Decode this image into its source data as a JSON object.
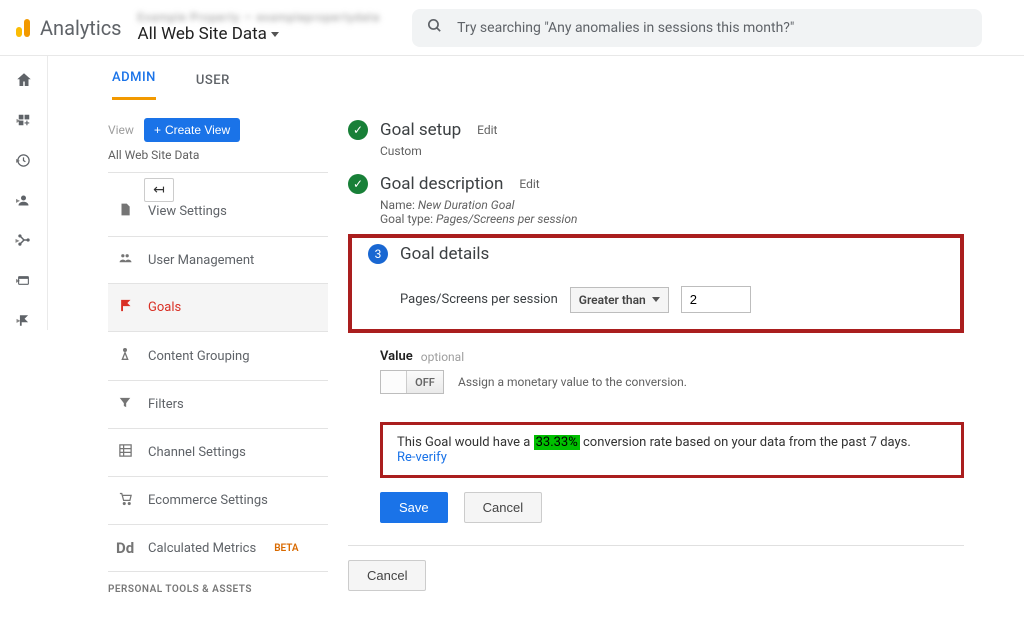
{
  "header": {
    "product": "Analytics",
    "property_top": "Example Property — examplepropertydata",
    "property_bottom": "All Web Site Data",
    "search_placeholder": "Try searching \"Any anomalies in sessions this month?\""
  },
  "tabs": {
    "admin": "ADMIN",
    "user": "USER"
  },
  "sidebar": {
    "view_label": "View",
    "create_view": "Create View",
    "view_name": "All Web Site Data",
    "items": [
      {
        "label": "View Settings"
      },
      {
        "label": "User Management"
      },
      {
        "label": "Goals"
      },
      {
        "label": "Content Grouping"
      },
      {
        "label": "Filters"
      },
      {
        "label": "Channel Settings"
      },
      {
        "label": "Ecommerce Settings"
      },
      {
        "label": "Calculated Metrics",
        "beta": "BETA"
      }
    ],
    "section_heading": "PERSONAL TOOLS & ASSETS"
  },
  "form": {
    "step1": {
      "title": "Goal setup",
      "edit": "Edit",
      "sub": "Custom"
    },
    "step2": {
      "title": "Goal description",
      "edit": "Edit",
      "name_label": "Name: ",
      "name_value": "New Duration Goal",
      "type_label": "Goal type: ",
      "type_value": "Pages/Screens per session"
    },
    "step3": {
      "number": "3",
      "title": "Goal details",
      "field_label": "Pages/Screens per session",
      "condition": "Greater than",
      "value": "2"
    },
    "value": {
      "label": "Value",
      "optional": "optional",
      "toggle": "OFF",
      "assign": "Assign a monetary value to the conversion."
    },
    "verify": {
      "prefix": "This Goal would have a ",
      "percent": "33.33%",
      "suffix": " conversion rate based on your data from the past 7 days.",
      "reverify": "Re-verify"
    },
    "buttons": {
      "save": "Save",
      "cancel": "Cancel",
      "cancel2": "Cancel"
    }
  }
}
